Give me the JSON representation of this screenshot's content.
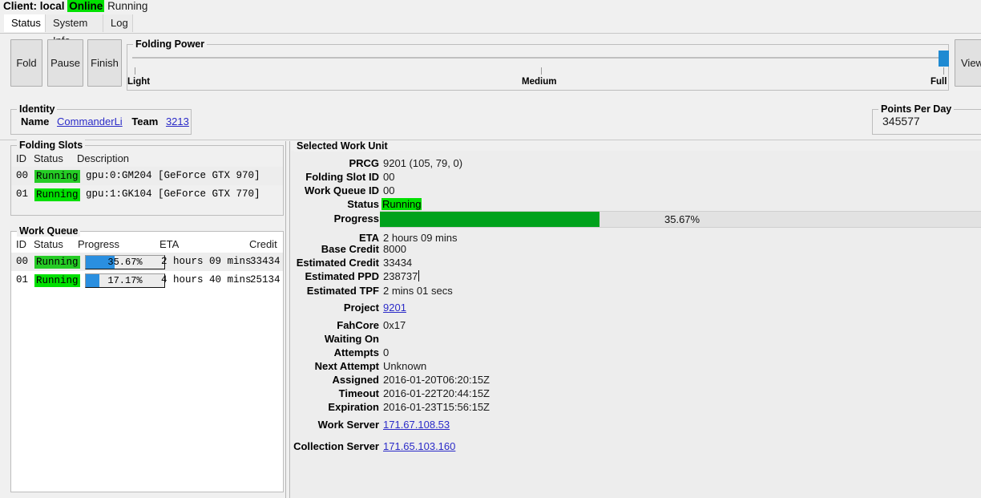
{
  "header": {
    "client_label": "Client: local",
    "connection_status": "Online",
    "run_status": "Running"
  },
  "tabs": [
    {
      "label": "Status",
      "active": true
    },
    {
      "label": "System Info",
      "active": false
    },
    {
      "label": "Log",
      "active": false
    }
  ],
  "toolbar": {
    "fold_label": "Fold",
    "pause_label": "Pause",
    "finish_label": "Finish",
    "view_label": "View"
  },
  "folding_power": {
    "legend": "Folding Power",
    "ticks": [
      "Light",
      "Medium",
      "Full"
    ],
    "value": "Full"
  },
  "identity": {
    "legend": "Identity",
    "name_label": "Name",
    "name_value": "CommanderLi",
    "team_label": "Team",
    "team_value": "3213"
  },
  "points_per_day": {
    "legend": "Points Per Day",
    "value": "345577"
  },
  "folding_slots": {
    "legend": "Folding Slots",
    "columns": [
      "ID",
      "Status",
      "Description"
    ],
    "rows": [
      {
        "id": "00",
        "status": "Running",
        "description": "gpu:0:GM204 [GeForce GTX 970]"
      },
      {
        "id": "01",
        "status": "Running",
        "description": "gpu:1:GK104 [GeForce GTX 770]"
      }
    ]
  },
  "work_queue": {
    "legend": "Work Queue",
    "columns": [
      "ID",
      "Status",
      "Progress",
      "ETA",
      "Credit"
    ],
    "rows": [
      {
        "id": "00",
        "status": "Running",
        "progress_text": "35.67%",
        "progress_pct": 35.67,
        "eta": "2 hours 09 mins",
        "credit": "33434"
      },
      {
        "id": "01",
        "status": "Running",
        "progress_text": "17.17%",
        "progress_pct": 17.17,
        "eta": "4 hours 40 mins",
        "credit": "25134"
      }
    ]
  },
  "selected_work_unit": {
    "legend": "Selected Work Unit",
    "fields": [
      {
        "label": "PRCG",
        "value": "9201 (105, 79, 0)"
      },
      {
        "label": "Folding Slot ID",
        "value": "00"
      },
      {
        "label": "Work Queue ID",
        "value": "00"
      },
      {
        "label": "Status",
        "value": "Running"
      },
      {
        "label": "Progress",
        "value": "35.67%"
      },
      {
        "label": "ETA",
        "value": "2 hours 09 mins"
      },
      {
        "label": "Base Credit",
        "value": "8000"
      },
      {
        "label": "Estimated Credit",
        "value": "33434"
      },
      {
        "label": "Estimated PPD",
        "value": "238737"
      },
      {
        "label": "Estimated TPF",
        "value": "2 mins 01 secs"
      },
      {
        "label": "Project",
        "value": "9201"
      },
      {
        "label": "FahCore",
        "value": "0x17"
      },
      {
        "label": "Waiting On",
        "value": ""
      },
      {
        "label": "Attempts",
        "value": "0"
      },
      {
        "label": "Next Attempt",
        "value": "Unknown"
      },
      {
        "label": "Assigned",
        "value": "2016-01-20T06:20:15Z"
      },
      {
        "label": "Timeout",
        "value": "2016-01-22T20:44:15Z"
      },
      {
        "label": "Expiration",
        "value": "2016-01-23T15:56:15Z"
      },
      {
        "label": "Work Server",
        "value": "171.67.108.53"
      },
      {
        "label": "Collection Server",
        "value": "171.65.103.160"
      }
    ],
    "progress_pct": 35.67,
    "progress_text": "35.67%"
  },
  "colors": {
    "accent_blue": "#2a8fe0",
    "status_green": "#00e000",
    "progress_green": "#00a21c",
    "link": "#2b2bc8",
    "window_bg": "#f0f0f0"
  }
}
